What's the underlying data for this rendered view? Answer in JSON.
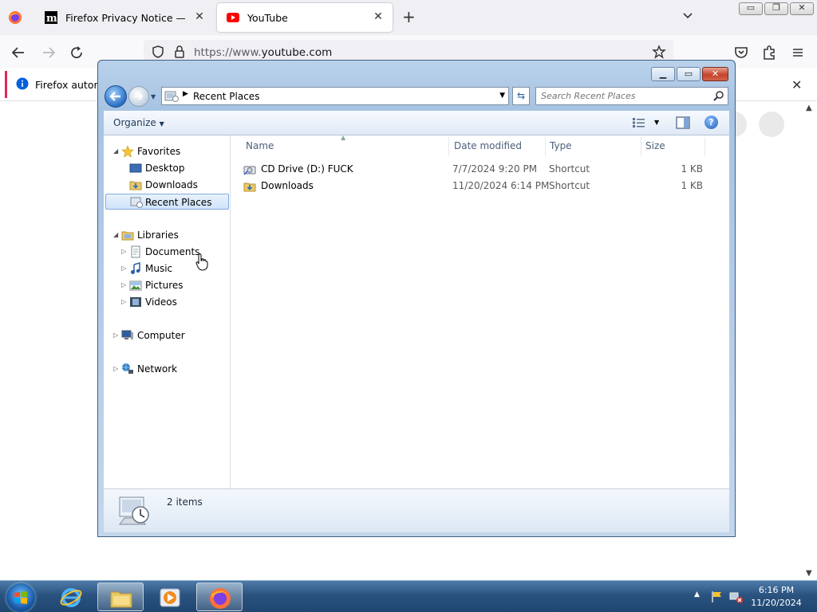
{
  "browser": {
    "tabs": [
      {
        "title": "Firefox Privacy Notice — Mozill",
        "icon": "mozilla-m-icon",
        "close": "✕"
      },
      {
        "title": "YouTube",
        "icon": "youtube-icon",
        "close": "✕"
      }
    ],
    "new_tab": "+",
    "url_prefix": "https://www.",
    "url_domain": "youtube.com",
    "notice": "Firefox automa",
    "notice_close": "✕"
  },
  "explorer": {
    "address_path": "Recent Places",
    "search_placeholder": "Search Recent Places",
    "organize_label": "Organize",
    "help_glyph": "?",
    "nav": {
      "favorites": "Favorites",
      "desktop": "Desktop",
      "downloads": "Downloads",
      "recent_places": "Recent Places",
      "libraries": "Libraries",
      "documents": "Documents",
      "music": "Music",
      "pictures": "Pictures",
      "videos": "Videos",
      "computer": "Computer",
      "network": "Network"
    },
    "columns": {
      "name": "Name",
      "date": "Date modified",
      "type": "Type",
      "size": "Size"
    },
    "files": [
      {
        "name": "CD Drive (D:) FUCK",
        "date": "7/7/2024 9:20 PM",
        "type": "Shortcut",
        "size": "1 KB",
        "icon": "cd-drive-icon"
      },
      {
        "name": "Downloads",
        "date": "11/20/2024 6:14 PM",
        "type": "Shortcut",
        "size": "1 KB",
        "icon": "downloads-folder-icon"
      }
    ],
    "status": "2 items"
  },
  "taskbar": {
    "time": "6:16 PM",
    "date": "11/20/2024"
  },
  "colors": {
    "accent_blue": "#2b6fc4",
    "selection": "#cfe3fa",
    "taskbar": "#2b5380"
  }
}
